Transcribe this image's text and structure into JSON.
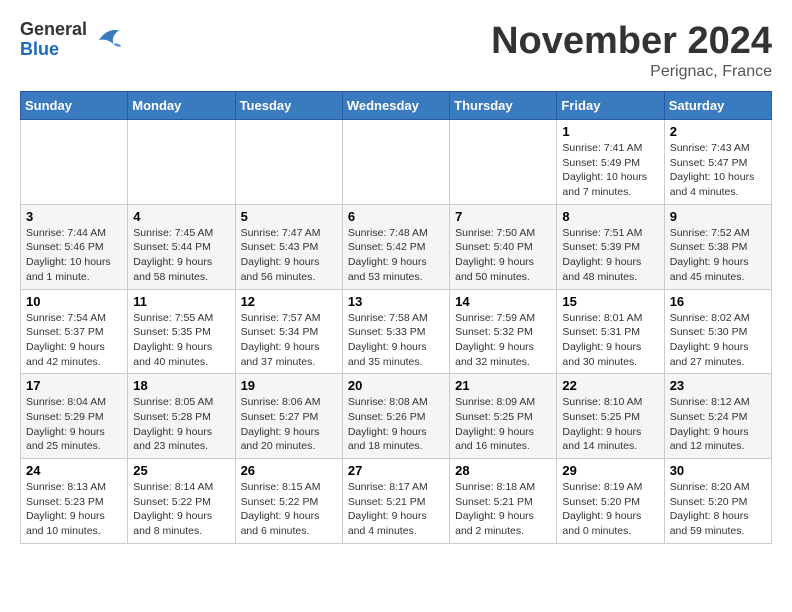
{
  "header": {
    "logo": {
      "general": "General",
      "blue": "Blue"
    },
    "title": "November 2024",
    "location": "Perignac, France"
  },
  "days_of_week": [
    "Sunday",
    "Monday",
    "Tuesday",
    "Wednesday",
    "Thursday",
    "Friday",
    "Saturday"
  ],
  "weeks": [
    {
      "days": [
        {
          "num": "",
          "info": ""
        },
        {
          "num": "",
          "info": ""
        },
        {
          "num": "",
          "info": ""
        },
        {
          "num": "",
          "info": ""
        },
        {
          "num": "",
          "info": ""
        },
        {
          "num": "1",
          "info": "Sunrise: 7:41 AM\nSunset: 5:49 PM\nDaylight: 10 hours and 7 minutes."
        },
        {
          "num": "2",
          "info": "Sunrise: 7:43 AM\nSunset: 5:47 PM\nDaylight: 10 hours and 4 minutes."
        }
      ]
    },
    {
      "days": [
        {
          "num": "3",
          "info": "Sunrise: 7:44 AM\nSunset: 5:46 PM\nDaylight: 10 hours and 1 minute."
        },
        {
          "num": "4",
          "info": "Sunrise: 7:45 AM\nSunset: 5:44 PM\nDaylight: 9 hours and 58 minutes."
        },
        {
          "num": "5",
          "info": "Sunrise: 7:47 AM\nSunset: 5:43 PM\nDaylight: 9 hours and 56 minutes."
        },
        {
          "num": "6",
          "info": "Sunrise: 7:48 AM\nSunset: 5:42 PM\nDaylight: 9 hours and 53 minutes."
        },
        {
          "num": "7",
          "info": "Sunrise: 7:50 AM\nSunset: 5:40 PM\nDaylight: 9 hours and 50 minutes."
        },
        {
          "num": "8",
          "info": "Sunrise: 7:51 AM\nSunset: 5:39 PM\nDaylight: 9 hours and 48 minutes."
        },
        {
          "num": "9",
          "info": "Sunrise: 7:52 AM\nSunset: 5:38 PM\nDaylight: 9 hours and 45 minutes."
        }
      ]
    },
    {
      "days": [
        {
          "num": "10",
          "info": "Sunrise: 7:54 AM\nSunset: 5:37 PM\nDaylight: 9 hours and 42 minutes."
        },
        {
          "num": "11",
          "info": "Sunrise: 7:55 AM\nSunset: 5:35 PM\nDaylight: 9 hours and 40 minutes."
        },
        {
          "num": "12",
          "info": "Sunrise: 7:57 AM\nSunset: 5:34 PM\nDaylight: 9 hours and 37 minutes."
        },
        {
          "num": "13",
          "info": "Sunrise: 7:58 AM\nSunset: 5:33 PM\nDaylight: 9 hours and 35 minutes."
        },
        {
          "num": "14",
          "info": "Sunrise: 7:59 AM\nSunset: 5:32 PM\nDaylight: 9 hours and 32 minutes."
        },
        {
          "num": "15",
          "info": "Sunrise: 8:01 AM\nSunset: 5:31 PM\nDaylight: 9 hours and 30 minutes."
        },
        {
          "num": "16",
          "info": "Sunrise: 8:02 AM\nSunset: 5:30 PM\nDaylight: 9 hours and 27 minutes."
        }
      ]
    },
    {
      "days": [
        {
          "num": "17",
          "info": "Sunrise: 8:04 AM\nSunset: 5:29 PM\nDaylight: 9 hours and 25 minutes."
        },
        {
          "num": "18",
          "info": "Sunrise: 8:05 AM\nSunset: 5:28 PM\nDaylight: 9 hours and 23 minutes."
        },
        {
          "num": "19",
          "info": "Sunrise: 8:06 AM\nSunset: 5:27 PM\nDaylight: 9 hours and 20 minutes."
        },
        {
          "num": "20",
          "info": "Sunrise: 8:08 AM\nSunset: 5:26 PM\nDaylight: 9 hours and 18 minutes."
        },
        {
          "num": "21",
          "info": "Sunrise: 8:09 AM\nSunset: 5:25 PM\nDaylight: 9 hours and 16 minutes."
        },
        {
          "num": "22",
          "info": "Sunrise: 8:10 AM\nSunset: 5:25 PM\nDaylight: 9 hours and 14 minutes."
        },
        {
          "num": "23",
          "info": "Sunrise: 8:12 AM\nSunset: 5:24 PM\nDaylight: 9 hours and 12 minutes."
        }
      ]
    },
    {
      "days": [
        {
          "num": "24",
          "info": "Sunrise: 8:13 AM\nSunset: 5:23 PM\nDaylight: 9 hours and 10 minutes."
        },
        {
          "num": "25",
          "info": "Sunrise: 8:14 AM\nSunset: 5:22 PM\nDaylight: 9 hours and 8 minutes."
        },
        {
          "num": "26",
          "info": "Sunrise: 8:15 AM\nSunset: 5:22 PM\nDaylight: 9 hours and 6 minutes."
        },
        {
          "num": "27",
          "info": "Sunrise: 8:17 AM\nSunset: 5:21 PM\nDaylight: 9 hours and 4 minutes."
        },
        {
          "num": "28",
          "info": "Sunrise: 8:18 AM\nSunset: 5:21 PM\nDaylight: 9 hours and 2 minutes."
        },
        {
          "num": "29",
          "info": "Sunrise: 8:19 AM\nSunset: 5:20 PM\nDaylight: 9 hours and 0 minutes."
        },
        {
          "num": "30",
          "info": "Sunrise: 8:20 AM\nSunset: 5:20 PM\nDaylight: 8 hours and 59 minutes."
        }
      ]
    }
  ]
}
